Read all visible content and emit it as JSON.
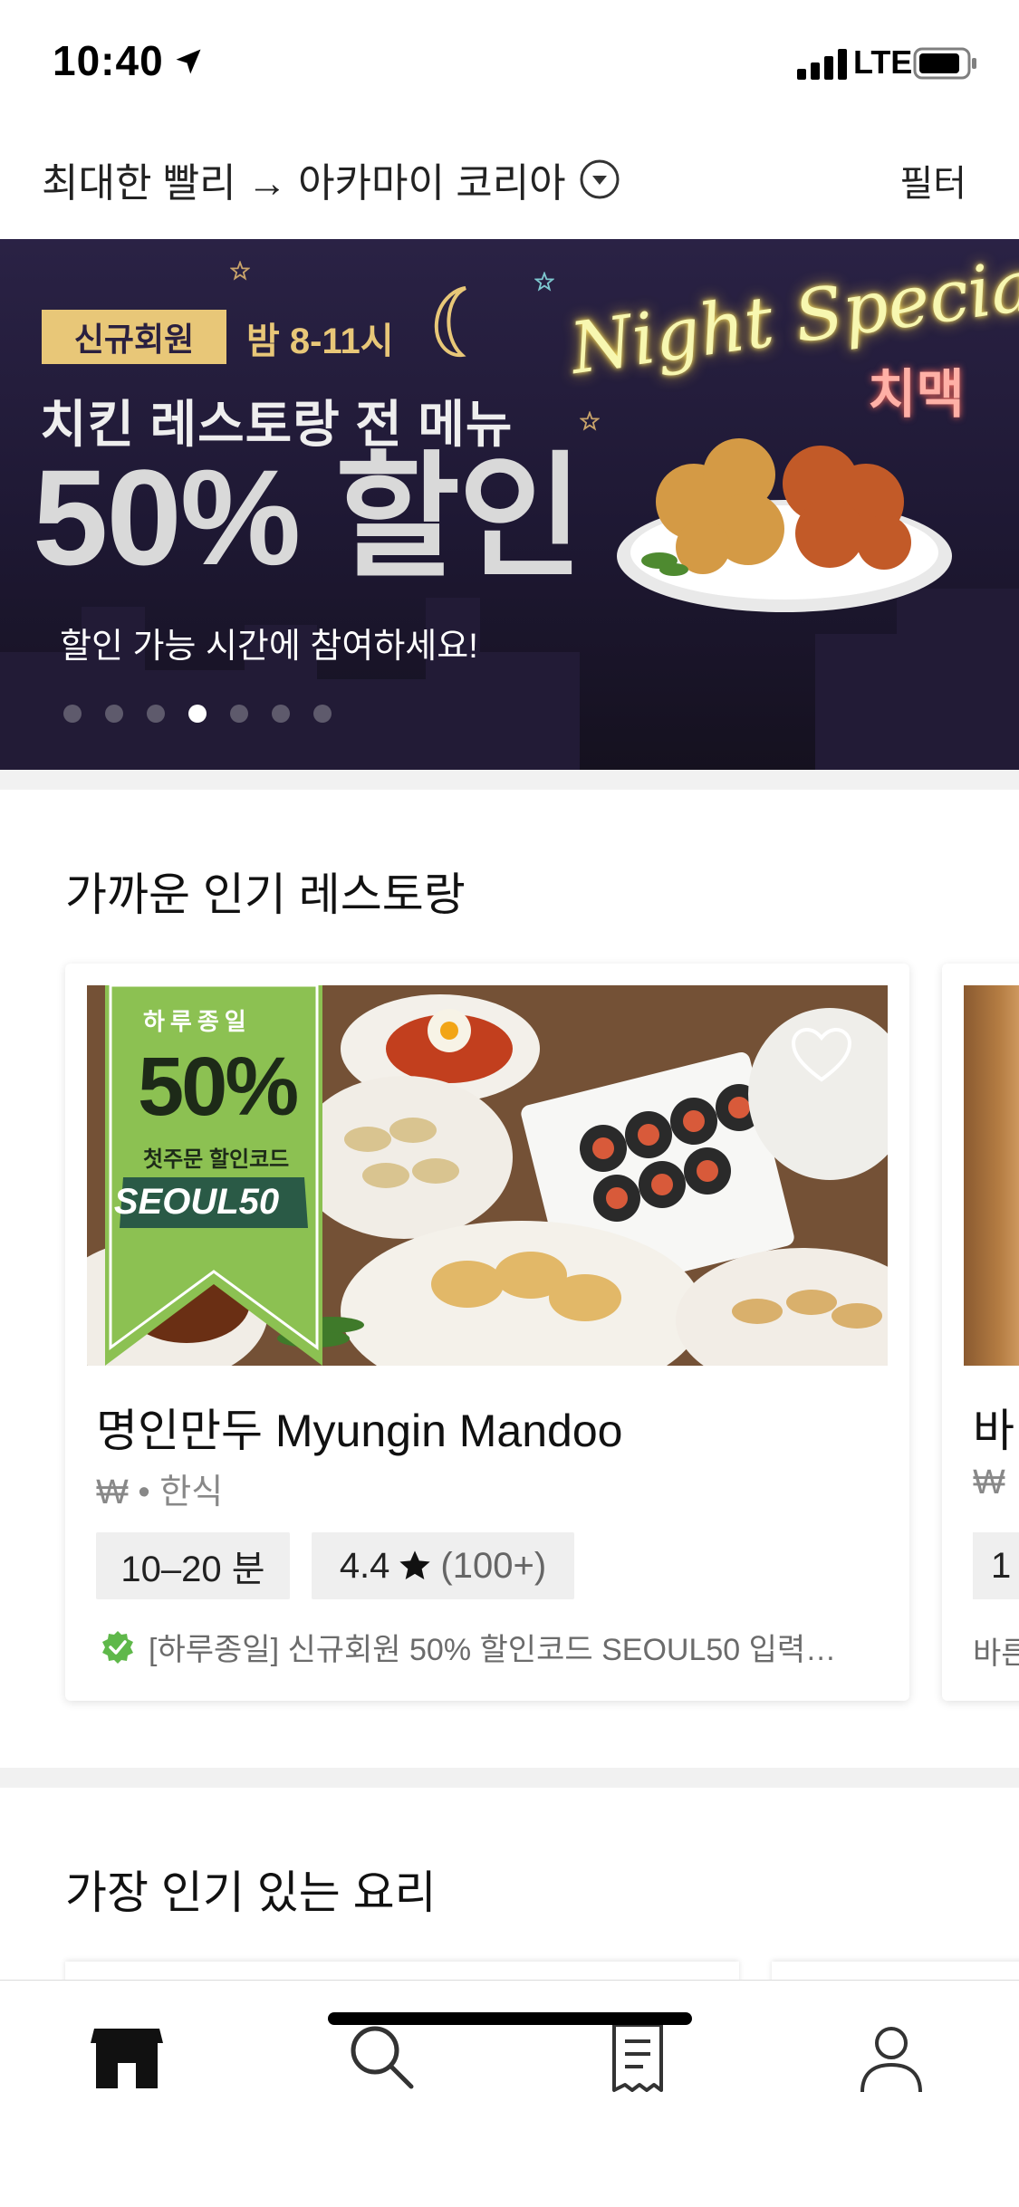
{
  "status_bar": {
    "time": "10:40",
    "network": "LTE"
  },
  "header": {
    "location": "최대한 빨리 → 아카마이 코리아",
    "filter_label": "필터"
  },
  "banner": {
    "badge": "신규회원",
    "time_text": "밤 8-11시",
    "line1": "치킨 레스토랑 전 메뉴",
    "line2": "50% 할인",
    "line3": "할인 가능 시간에 참여하세요!",
    "neon_title": "Night Special",
    "neon_subtitle": "치맥",
    "dots_total": 7,
    "active_dot": 4
  },
  "section_nearby": {
    "title": "가까운 인기 레스토랑",
    "cards": [
      {
        "name": "명인만두 Myungin Mandoo",
        "meta": "₩ • 한식",
        "delivery_time": "10–20 분",
        "rating": "4.4",
        "rating_count": "(100+)",
        "promo": "[하루종일] 신규회원 50% 할인코드 SEOUL50 입력…",
        "ribbon": {
          "top": "하루종일",
          "percent": "50%",
          "sub": "첫주문 할인코드",
          "code": "SEOUL50"
        }
      },
      {
        "name": "바",
        "meta": "₩",
        "delivery_time": "1",
        "promo": "바른"
      }
    ]
  },
  "section_popular": {
    "title": "가장 인기 있는 요리"
  },
  "tab_bar": {
    "items": [
      {
        "name": "home",
        "icon": "storefront-icon",
        "active": true
      },
      {
        "name": "search",
        "icon": "search-icon",
        "active": false
      },
      {
        "name": "orders",
        "icon": "receipt-icon",
        "active": false
      },
      {
        "name": "account",
        "icon": "person-icon",
        "active": false
      }
    ]
  },
  "colors": {
    "banner_gold": "#e8c778",
    "promo_green": "#5fb84a",
    "ribbon_green": "#8cc152"
  }
}
